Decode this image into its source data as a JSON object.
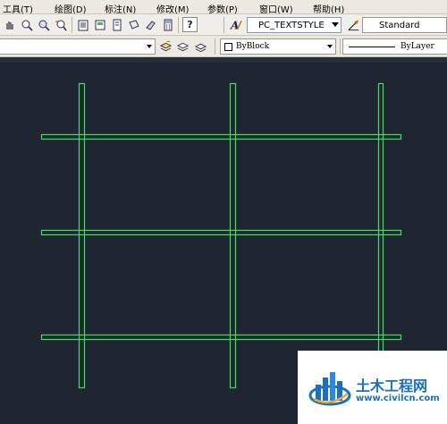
{
  "menu": {
    "items": [
      {
        "label": "工具(T)",
        "name": "menu-tools"
      },
      {
        "label": "绘图(D)",
        "name": "menu-draw"
      },
      {
        "label": "标注(N)",
        "name": "menu-dimension"
      },
      {
        "label": "修改(M)",
        "name": "menu-modify"
      },
      {
        "label": "参数(P)",
        "name": "menu-parametric"
      },
      {
        "label": "窗口(W)",
        "name": "menu-window"
      },
      {
        "label": "帮助(H)",
        "name": "menu-help"
      }
    ]
  },
  "toolbar": {
    "text_style": "PC_TEXTSTYLE",
    "dim_style": "Standard",
    "color_value": "ByBlock",
    "linetype_value": "ByLayer"
  },
  "watermark": {
    "title": "土木工程网",
    "url": "www.civilcn.com"
  },
  "colors": {
    "canvas": "#1f2632",
    "grid_line": "#3ce05a",
    "brand_blue": "#1a6fc0"
  }
}
